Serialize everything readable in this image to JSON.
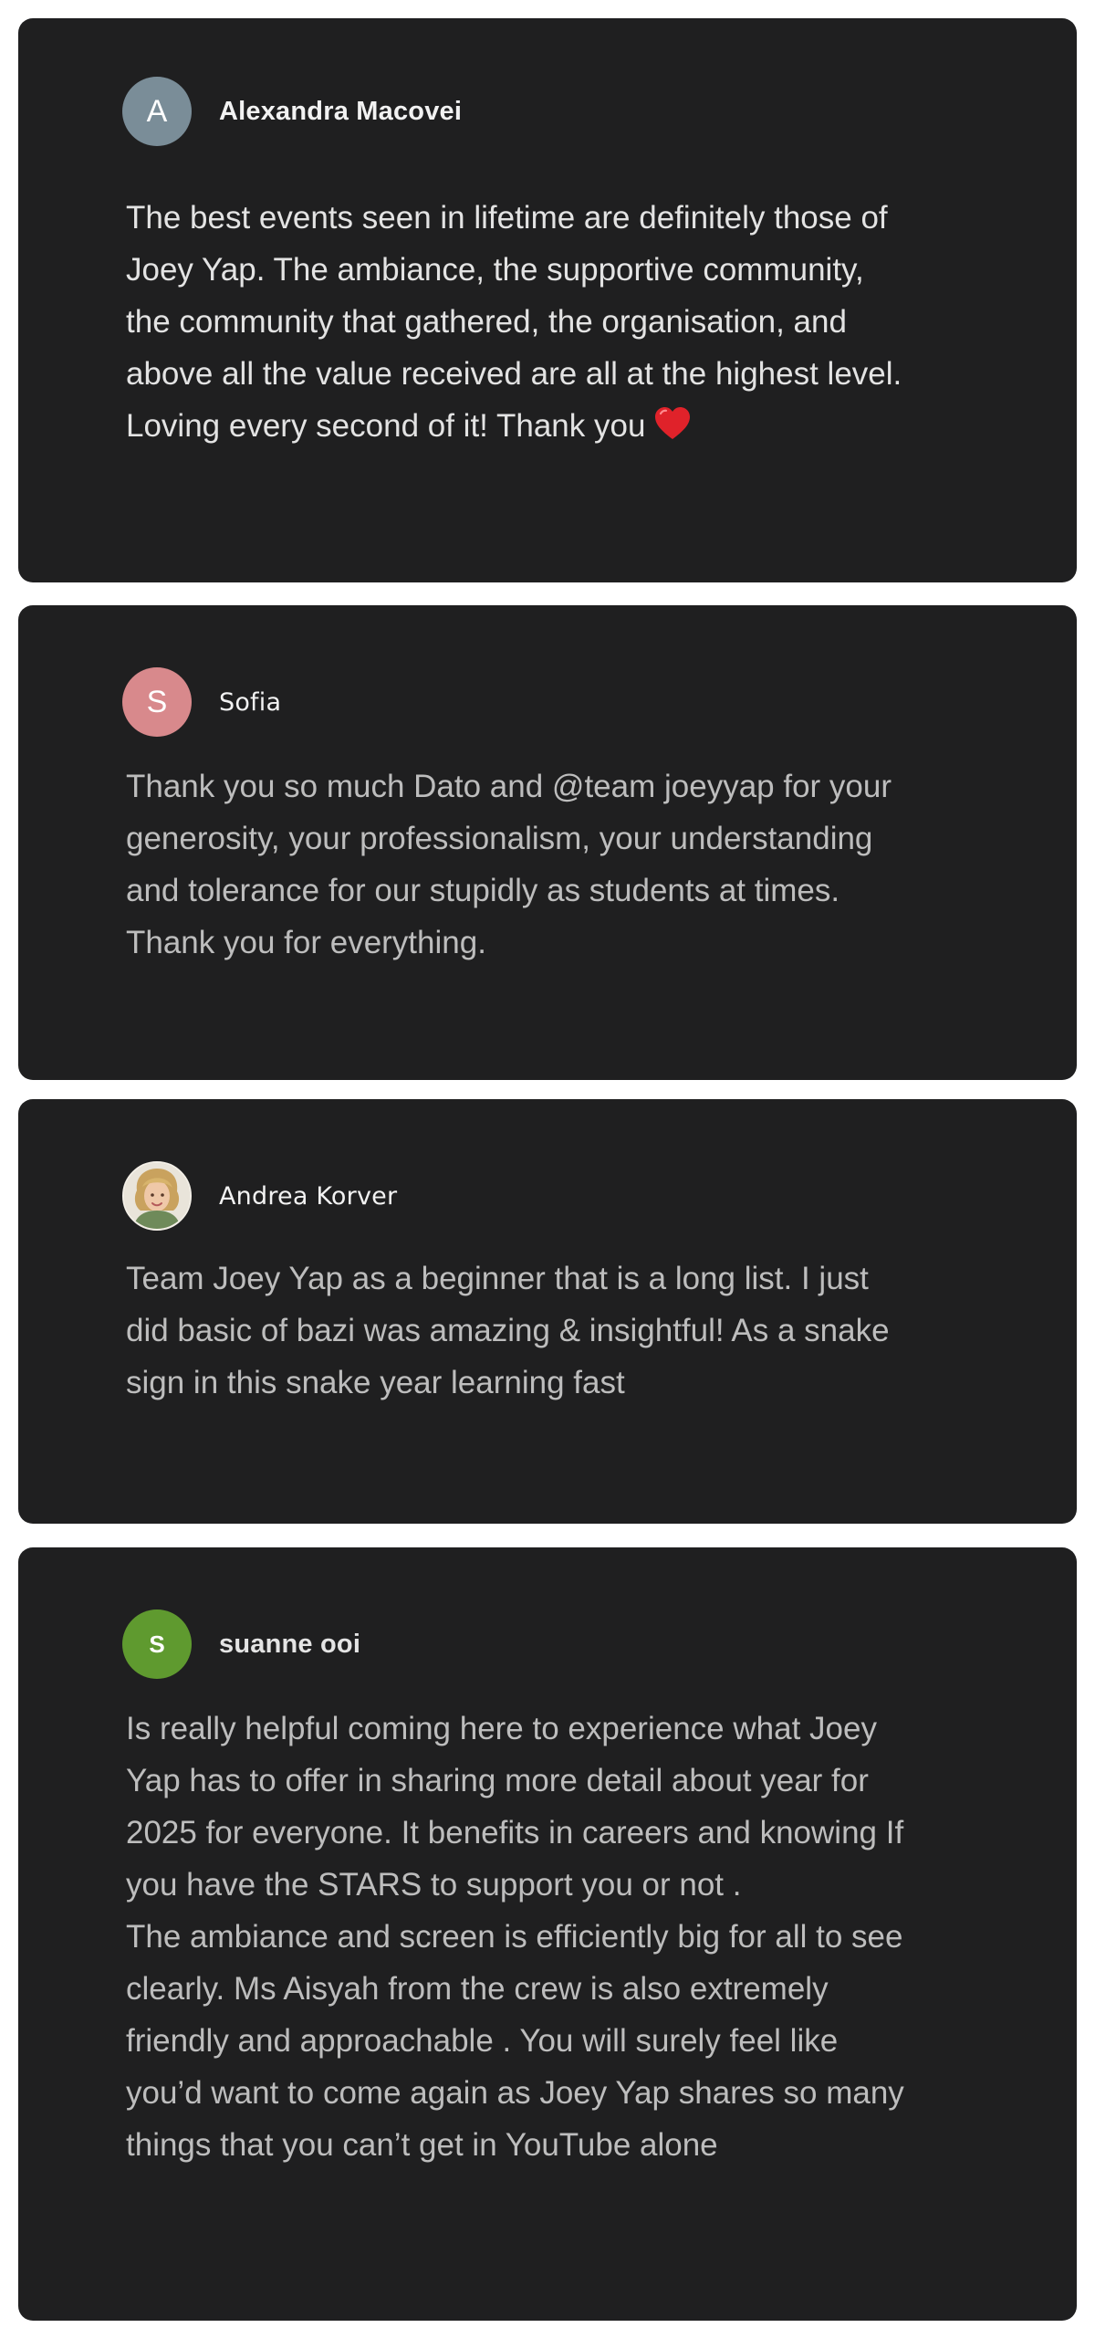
{
  "reviews": [
    {
      "avatar": {
        "letter": "A",
        "color": "#7a8d98"
      },
      "name": "Alexandra Macovei",
      "text": "The best events seen in lifetime are definitely those of\nJoey Yap. The ambiance, the supportive community,\nthe community that gathered, the organisation, and\nabove all the value received are all at the highest level.\nLoving every second of it! Thank you",
      "emoji": "heart-icon"
    },
    {
      "avatar": {
        "letter": "S",
        "color": "#d8898c"
      },
      "name": "Sofia",
      "text": "Thank you so much Dato and @team joeyyap for your\ngenerosity, your professionalism, your understanding\nand tolerance for our stupidly as students at times.\nThank you for everything."
    },
    {
      "avatar": {
        "icon": "profile-photo"
      },
      "name": "Andrea Korver",
      "text": "Team Joey Yap as a beginner that is a long list. I just\ndid basic of bazi was amazing & insightful! As a snake\nsign in this snake year learning fast"
    },
    {
      "avatar": {
        "letter": "S",
        "color": "#5f9a2f"
      },
      "name": "suanne ooi",
      "text": "Is really helpful coming here to experience what Joey\nYap has to offer in sharing more detail about year for\n2025 for everyone. It benefits in careers and knowing If\nyou have the STARS to support you or not .\nThe ambiance and screen is efficiently big for all to see\nclearly. Ms Aisyah from the crew is also extremely\nfriendly and approachable . You will surely feel like\nyou’d want to come again as Joey Yap shares so many\nthings that you can’t get in YouTube alone"
    }
  ]
}
